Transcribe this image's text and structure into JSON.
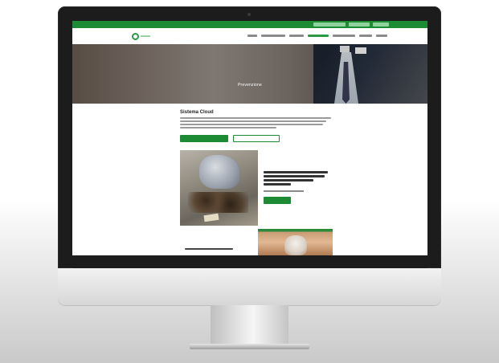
{
  "screen": {
    "hero": {
      "title": "Prevenzione"
    },
    "main": {
      "heading": "Sistema Cloud",
      "primary_button": "",
      "secondary_button": ""
    },
    "card": {
      "button": ""
    }
  },
  "colors": {
    "brand_green": "#1d8a34",
    "monitor_bezel": "#1c1c1c",
    "monitor_chin": "#e4e4e4"
  }
}
